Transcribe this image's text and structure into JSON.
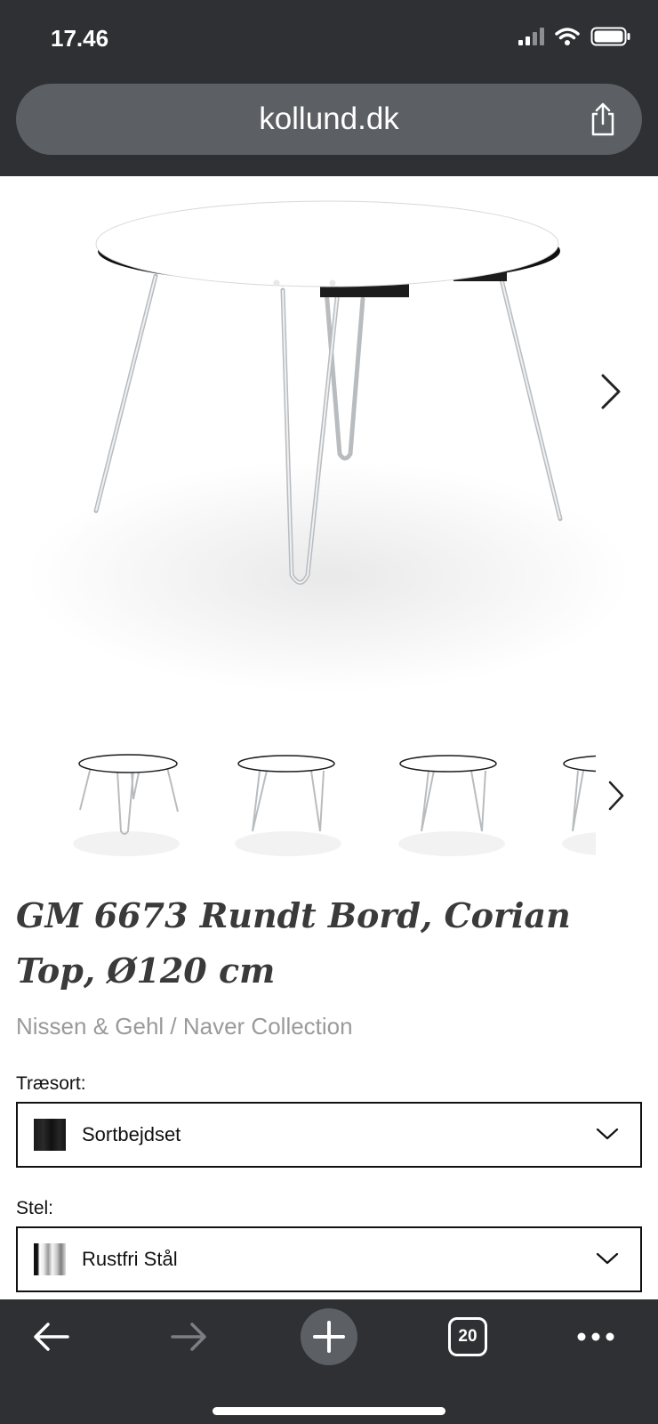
{
  "status": {
    "time": "17.46"
  },
  "browser": {
    "url": "kollund.dk",
    "tab_count": "20"
  },
  "product": {
    "title": "GM 6673 Rundt Bord, Corian Top, Ø120 cm",
    "brand": "Nissen & Gehl / Naver Collection"
  },
  "options": {
    "wood_label": "Træsort:",
    "wood_value": "Sortbejdset",
    "frame_label": "Stel:",
    "frame_value": "Rustfri Stål"
  },
  "icons": {
    "share": "share-icon",
    "next": "chevron-right-icon",
    "dropdown": "chevron-down-icon",
    "back": "arrow-left-icon",
    "forward": "arrow-right-icon",
    "new_tab": "plus-icon",
    "more": "more-dots-icon"
  },
  "colors": {
    "chrome": "#2e3033",
    "url_bar": "#5c6064",
    "text": "#3a3a3a",
    "muted": "#9a9a9a"
  }
}
